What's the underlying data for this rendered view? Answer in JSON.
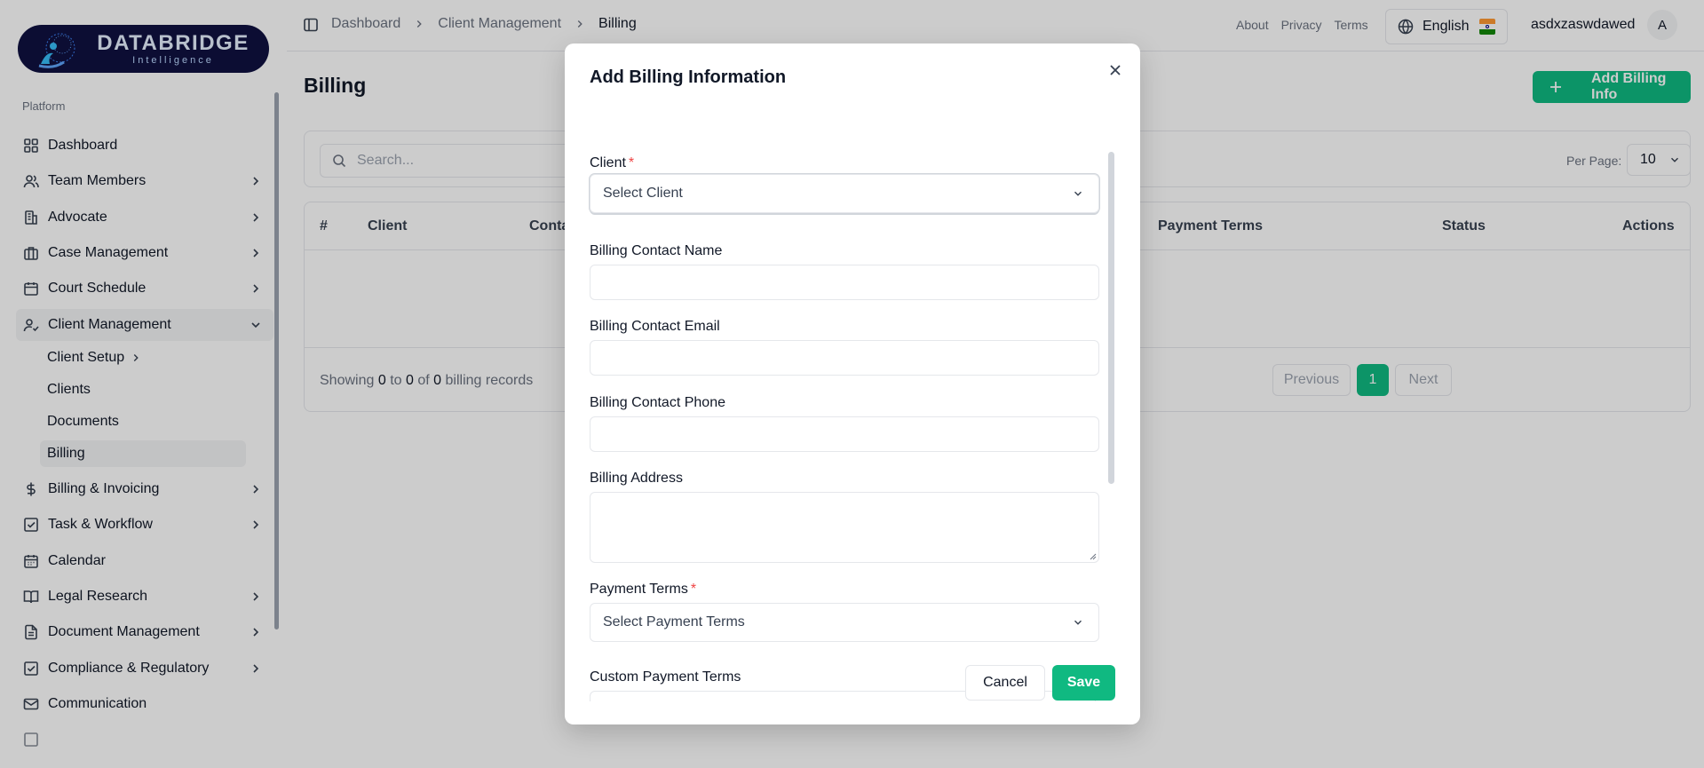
{
  "brand": {
    "name": "DATABRIDGE",
    "tagline": "Intelligence",
    "colors": {
      "logo_bg": "#0f1140",
      "accent": "#10b981"
    }
  },
  "sidebar": {
    "section": "Platform",
    "items": [
      {
        "label": "Dashboard",
        "icon": "grid-icon"
      },
      {
        "label": "Team Members",
        "icon": "users-icon"
      },
      {
        "label": "Advocate",
        "icon": "building-icon"
      },
      {
        "label": "Case Management",
        "icon": "briefcase-icon"
      },
      {
        "label": "Court Schedule",
        "icon": "calendar-icon"
      },
      {
        "label": "Client Management",
        "icon": "user-check-icon"
      },
      {
        "label": "Billing & Invoicing",
        "icon": "dollar-icon"
      },
      {
        "label": "Task & Workflow",
        "icon": "check-square-icon"
      },
      {
        "label": "Calendar",
        "icon": "calendar-days-icon"
      },
      {
        "label": "Legal Research",
        "icon": "book-icon"
      },
      {
        "label": "Document Management",
        "icon": "file-text-icon"
      },
      {
        "label": "Compliance & Regulatory",
        "icon": "check-square-icon"
      },
      {
        "label": "Communication",
        "icon": "mail-icon"
      }
    ],
    "subitems": [
      {
        "label": "Client Setup"
      },
      {
        "label": "Clients"
      },
      {
        "label": "Documents"
      },
      {
        "label": "Billing"
      }
    ]
  },
  "topbar": {
    "breadcrumb": [
      "Dashboard",
      "Client Management",
      "Billing"
    ],
    "links": [
      "About",
      "Privacy",
      "Terms"
    ],
    "language": "English",
    "username": "asdxzaswdawed",
    "avatar_initial": "A"
  },
  "page": {
    "title": "Billing",
    "add_button": "Add Billing Info",
    "search_placeholder": "Search...",
    "per_page_label": "Per Page:",
    "per_page_value": "10"
  },
  "table": {
    "columns": [
      "#",
      "Client",
      "Conta",
      "Payment Terms",
      "Status",
      "Actions"
    ],
    "showing": {
      "prefix": "Showing",
      "from": "0",
      "to_word": "to",
      "to": "0",
      "of_word": "of",
      "total": "0",
      "suffix": "billing records"
    },
    "pagination": {
      "previous": "Previous",
      "current": "1",
      "next": "Next"
    }
  },
  "modal": {
    "title": "Add Billing Information",
    "fields": {
      "client": {
        "label": "Client",
        "required": "*",
        "placeholder": "Select Client"
      },
      "contact_name": {
        "label": "Billing Contact Name",
        "value": ""
      },
      "contact_email": {
        "label": "Billing Contact Email",
        "value": ""
      },
      "contact_phone": {
        "label": "Billing Contact Phone",
        "value": ""
      },
      "address": {
        "label": "Billing Address",
        "value": ""
      },
      "payment_terms": {
        "label": "Payment Terms",
        "required": "*",
        "placeholder": "Select Payment Terms"
      },
      "custom_terms": {
        "label": "Custom Payment Terms"
      }
    },
    "cancel": "Cancel",
    "save": "Save"
  }
}
